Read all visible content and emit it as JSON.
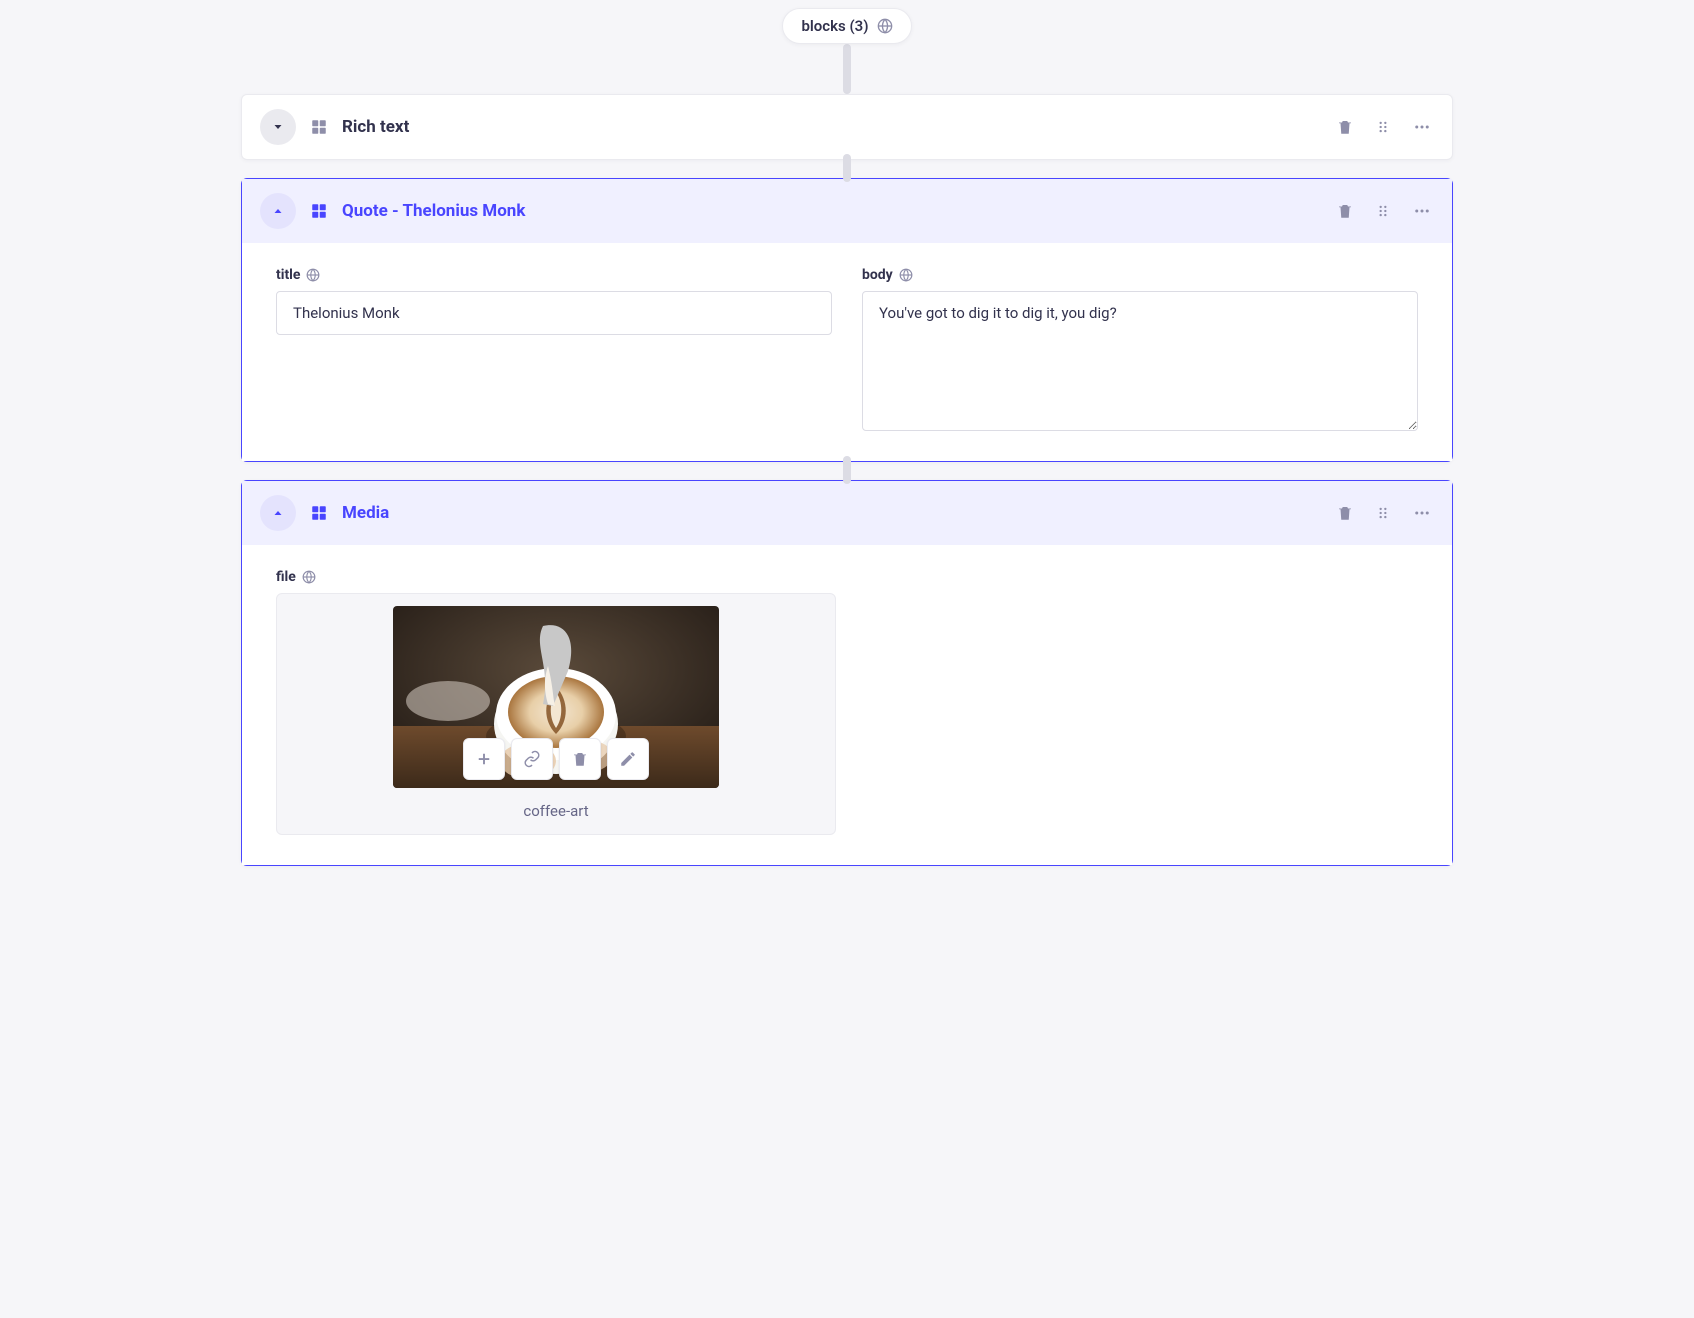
{
  "header": {
    "pill_label": "blocks (3)"
  },
  "blocks": [
    {
      "title": "Rich text",
      "expanded": false,
      "selected": false
    },
    {
      "title": "Quote - Thelonius Monk",
      "expanded": true,
      "selected": true,
      "fields": {
        "title_label": "title",
        "title_value": "Thelonius Monk",
        "body_label": "body",
        "body_value": "You've got to dig it to dig it, you dig?"
      }
    },
    {
      "title": "Media",
      "expanded": true,
      "selected": true,
      "file": {
        "label": "file",
        "name": "coffee-art"
      }
    }
  ]
}
